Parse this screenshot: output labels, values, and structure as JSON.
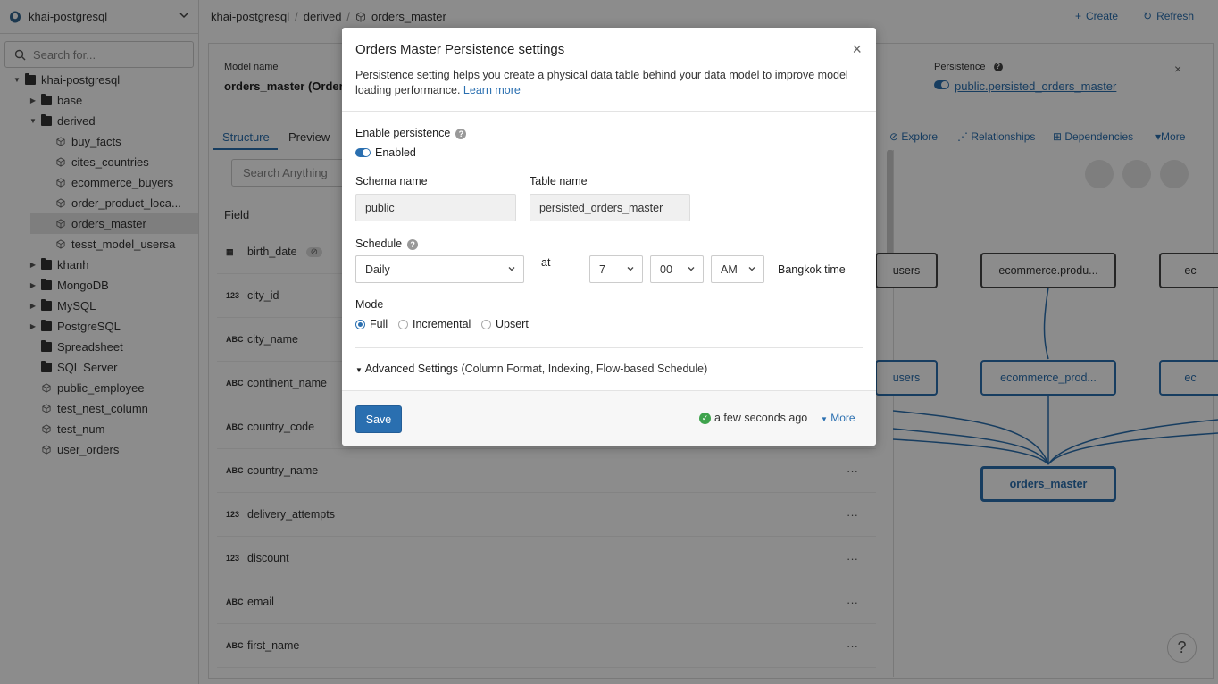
{
  "sidebar": {
    "datasource": "khai-postgresql",
    "search_placeholder": "Search for...",
    "tree": [
      {
        "label": "khai-postgresql",
        "type": "folder-root"
      },
      {
        "label": "base",
        "type": "folder"
      },
      {
        "label": "derived",
        "type": "folder-open"
      },
      {
        "label": "buy_facts",
        "type": "model"
      },
      {
        "label": "cites_countries",
        "type": "model"
      },
      {
        "label": "ecommerce_buyers",
        "type": "model"
      },
      {
        "label": "order_product_loca...",
        "type": "model"
      },
      {
        "label": "orders_master",
        "type": "model-selected"
      },
      {
        "label": "tesst_model_usersa",
        "type": "model"
      },
      {
        "label": "khanh",
        "type": "folder"
      },
      {
        "label": "MongoDB",
        "type": "folder"
      },
      {
        "label": "MySQL",
        "type": "folder"
      },
      {
        "label": "PostgreSQL",
        "type": "folder"
      },
      {
        "label": "Spreadsheet",
        "type": "folder-plain"
      },
      {
        "label": "SQL Server",
        "type": "folder-plain"
      },
      {
        "label": "public_employee",
        "type": "model-root"
      },
      {
        "label": "test_nest_column",
        "type": "model-root"
      },
      {
        "label": "test_num",
        "type": "model-root"
      },
      {
        "label": "user_orders",
        "type": "model-root"
      }
    ]
  },
  "header": {
    "breadcrumb": [
      "khai-postgresql",
      "derived",
      "orders_master"
    ],
    "create_label": "Create",
    "refresh_label": "Refresh"
  },
  "main": {
    "model_name_label": "Model name",
    "model_name": "orders_master (Orders",
    "persistence_label": "Persistence",
    "persistence_value": "public.persisted_orders_master",
    "tabs": [
      "Structure",
      "Preview"
    ],
    "search_placeholder": "Search Anything",
    "field_header": "Field",
    "actions": [
      "Explore",
      "Relationships",
      "Dependencies",
      "More"
    ],
    "fields": [
      {
        "type": "date",
        "name": "birth_date"
      },
      {
        "type": "123",
        "name": "city_id"
      },
      {
        "type": "ABC",
        "name": "city_name"
      },
      {
        "type": "ABC",
        "name": "continent_name"
      },
      {
        "type": "ABC",
        "name": "country_code"
      },
      {
        "type": "ABC",
        "name": "country_name"
      },
      {
        "type": "123",
        "name": "delivery_attempts"
      },
      {
        "type": "123",
        "name": "discount"
      },
      {
        "type": "ABC",
        "name": "email"
      },
      {
        "type": "ABC",
        "name": "first_name"
      }
    ],
    "graph": {
      "nodes": [
        "users",
        "ecommerce.produ...",
        "ec",
        "users",
        "ecommerce_prod...",
        "ec",
        "orders_master"
      ]
    }
  },
  "modal": {
    "title": "Orders Master Persistence settings",
    "description": "Persistence setting helps you create a physical data table behind your data model to improve model loading performance.",
    "learn_more": "Learn more",
    "enable_label": "Enable persistence",
    "enabled_text": "Enabled",
    "schema_label": "Schema name",
    "schema_value": "public",
    "table_label": "Table name",
    "table_value": "persisted_orders_master",
    "schedule_label": "Schedule",
    "schedule_value": "Daily",
    "at_label": "at",
    "hour": "7",
    "minute": "00",
    "ampm": "AM",
    "timezone": "Bangkok time",
    "mode_label": "Mode",
    "modes": [
      "Full",
      "Incremental",
      "Upsert"
    ],
    "mode_selected": "Full",
    "advanced_label": "Advanced Settings",
    "advanced_hint": "(Column Format, Indexing, Flow-based Schedule)",
    "save_label": "Save",
    "status_text": "a few seconds ago",
    "more_label": "More"
  },
  "help_label": "?"
}
